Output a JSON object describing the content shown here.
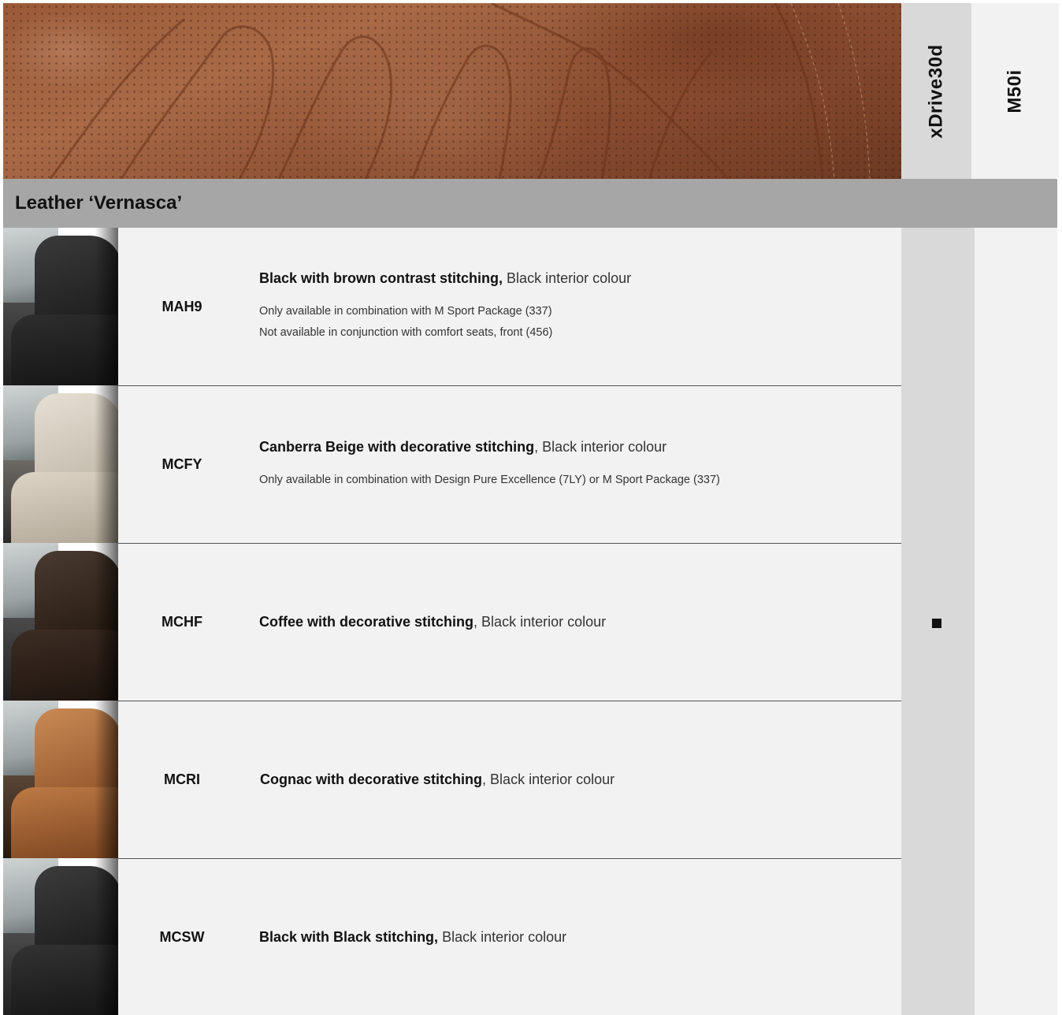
{
  "header": {
    "columns": [
      "xDrive30d",
      "M50i"
    ]
  },
  "section": {
    "title": "Leather ‘Vernasca’"
  },
  "colors": {
    "dark_column": "#d9d9d9",
    "light_column": "#f2f2f2",
    "section_bar": "#a6a6a6",
    "standard_marker": "#111111"
  },
  "rows": [
    {
      "code": "MAH9",
      "title_bold": "Black with brown contrast stitching,",
      "title_rest": " Black interior colour",
      "notes": [
        "Only available in combination with M Sport Package (337)",
        "Not available in conjunction with comfort seats, front (456)"
      ],
      "seat_color": "#232323"
    },
    {
      "code": "MCFY",
      "title_bold": "Canberra Beige with decorative stitching",
      "title_rest": ", Black interior colour",
      "notes": [
        "Only available in combination with Design Pure Excellence (7LY) or  M Sport Package (337)"
      ],
      "seat_color": "#d8d0c2"
    },
    {
      "code": "MCHF",
      "title_bold": "Coffee with decorative stitching",
      "title_rest": ", Black interior colour",
      "notes": [],
      "seat_color": "#3b2a22",
      "xDrive30d": "standard-marker-icon"
    },
    {
      "code": "MCRI",
      "title_bold": "Cognac with decorative stitching",
      "title_rest": ", Black interior colour",
      "notes": [],
      "seat_color": "#b9733f"
    },
    {
      "code": "MCSW",
      "title_bold": "Black with Black stitching,",
      "title_rest": " Black interior colour",
      "notes": [],
      "seat_color": "#2a2a2a"
    }
  ]
}
